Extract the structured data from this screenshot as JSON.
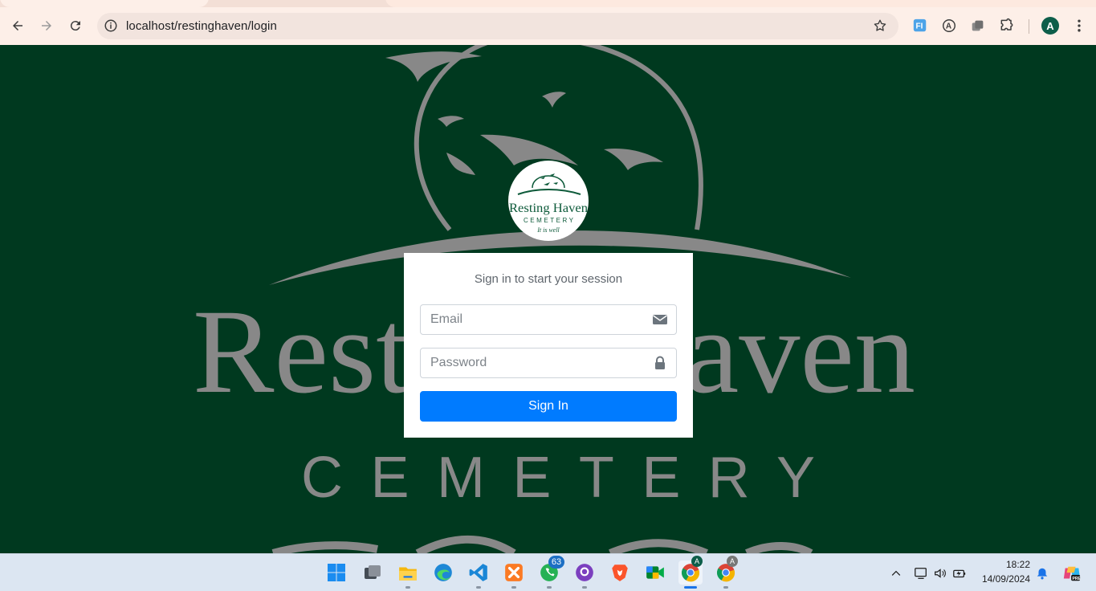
{
  "browser": {
    "url": "localhost/restinghaven/login",
    "profile_initial": "A",
    "extensions": [
      "feedly-extension-icon",
      "a-extension-icon",
      "tab-manager-icon",
      "extensions-puzzle-icon"
    ]
  },
  "page": {
    "background_color": "#00391f",
    "logo": {
      "name": "Resting Haven",
      "sub": "CEMETERY",
      "tagline": "It is well"
    },
    "background_logo": {
      "name": "Resting Haven",
      "sub": "CEMETERY"
    },
    "login": {
      "message": "Sign in to start your session",
      "email_placeholder": "Email",
      "password_placeholder": "Password",
      "submit_label": "Sign In",
      "submit_color": "#007bff"
    }
  },
  "taskbar": {
    "apps": [
      "windows-start-icon",
      "task-view-icon",
      "file-explorer-icon",
      "edge-icon",
      "vscode-icon",
      "xampp-icon",
      "whatsapp-icon",
      "github-desktop-icon",
      "brave-icon",
      "meet-icon",
      "chrome-icon",
      "chrome-profile-icon"
    ],
    "whatsapp_badge": "63",
    "chrome_profile_badge": "A",
    "chrome2_profile_badge": "A",
    "time": "18:22",
    "date": "14/09/2024"
  }
}
